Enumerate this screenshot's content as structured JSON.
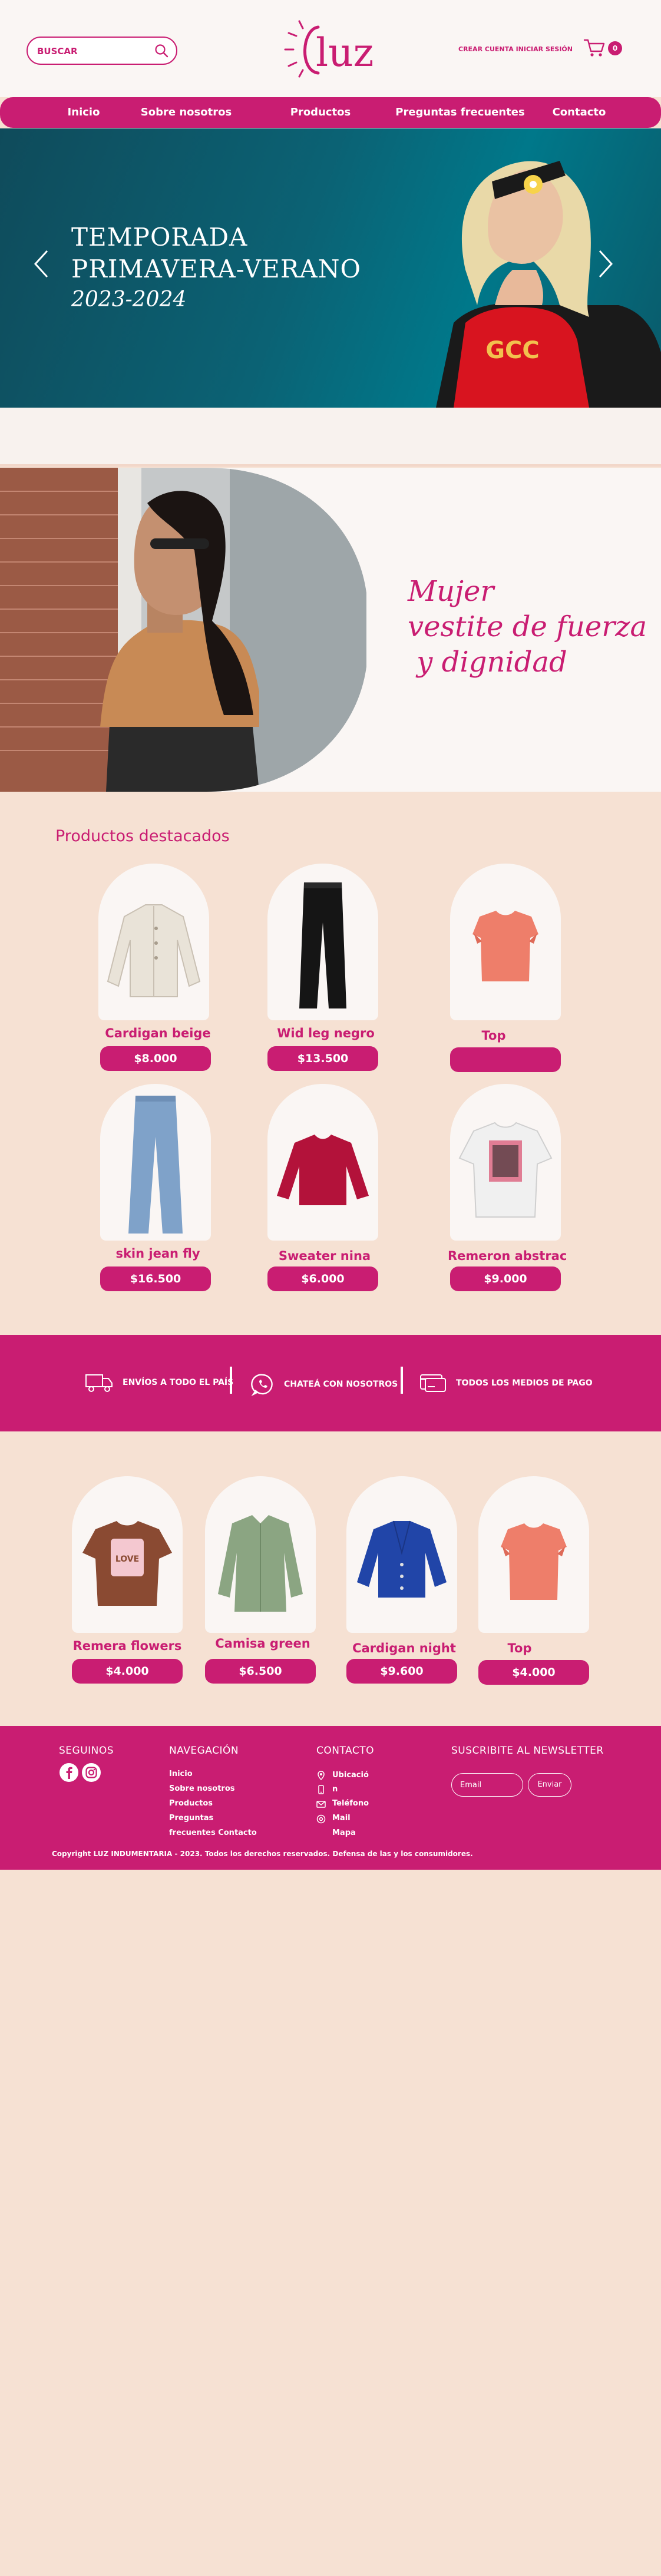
{
  "colors": {
    "brand": "#c91d72",
    "cream": "#faf6f4",
    "peach": "#f6e1d3",
    "hero": "#0b6274"
  },
  "header": {
    "search_label": "BUSCAR",
    "logo_text": "luz",
    "account_links": "CREAR CUENTA INICIAR SESIÓN",
    "cart_count": "0"
  },
  "nav": {
    "items": [
      "Inicio",
      "Sobre nosotros",
      "Productos",
      "Preguntas frecuentes",
      "Contacto"
    ]
  },
  "hero": {
    "line1": "TEMPORADA",
    "line2": "PRIMAVERA-VERANO",
    "line3": "2023-2024"
  },
  "about": {
    "line1": "Mujer",
    "line2": "vestite de fuerza",
    "line3": " y dignidad"
  },
  "featured": {
    "title": "Productos destacados",
    "products": [
      {
        "name": "Cardigan beige",
        "price": "$8.000",
        "icon": "cardigan-icon"
      },
      {
        "name": "Wid leg negro",
        "price": "$13.500",
        "icon": "trousers-icon"
      },
      {
        "name": "Top",
        "price": "",
        "icon": "top-icon"
      },
      {
        "name": "skin jean fly",
        "price": "$16.500",
        "icon": "jeans-icon"
      },
      {
        "name": "Sweater nina",
        "price": "$6.000",
        "icon": "sweater-icon"
      },
      {
        "name": "Remeron abstrac",
        "price": "$9.000",
        "icon": "tshirt-icon"
      }
    ]
  },
  "benefits": {
    "items": [
      {
        "label": "ENVÍOS A TODO EL PAÍS",
        "icon": "truck-icon"
      },
      {
        "label": "CHATEÁ CON NOSOTROS",
        "icon": "whatsapp-icon"
      },
      {
        "label": "TODOS LOS MEDIOS DE PAGO",
        "icon": "credit-card-icon"
      }
    ]
  },
  "more_products": {
    "products": [
      {
        "name": "Remera flowers",
        "price": "$4.000",
        "icon": "tshirt-icon"
      },
      {
        "name": "Camisa green",
        "price": "$6.500",
        "icon": "shirt-icon"
      },
      {
        "name": "Cardigan night",
        "price": "$9.600",
        "icon": "cardigan-icon"
      },
      {
        "name": "Top",
        "price": "$4.000",
        "icon": "top-icon"
      }
    ]
  },
  "footer": {
    "follow_title": "SEGUINOS",
    "nav_title": "NAVEGACIÓN",
    "nav_links": [
      "Inicio",
      "Sobre nosotros",
      "Productos",
      "Preguntas",
      "frecuentes Contacto"
    ],
    "contact_title": "CONTACTO",
    "contact_items": [
      "Ubicació",
      "n",
      "Teléfono",
      "Mail",
      "Mapa"
    ],
    "newsletter_title": "SUSCRIBITE AL NEWSLETTER",
    "email_placeholder": "Email",
    "send_label": "Enviar",
    "copyright": "Copyright LUZ INDUMENTARIA - 2023. Todos los derechos reservados. Defensa de las y los consumidores."
  }
}
